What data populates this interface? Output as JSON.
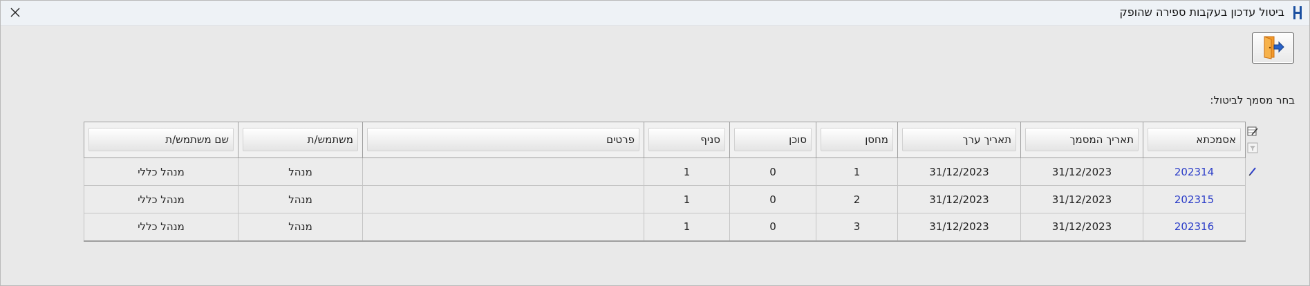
{
  "window": {
    "title": "ביטול עדכון בעקבות ספירה שהופק",
    "app_icon": "h-logo-icon",
    "close_icon": "close-icon"
  },
  "toolbar": {
    "exit_icon": "exit-door-icon"
  },
  "main": {
    "select_label": "בחר מסמך לביטול:"
  },
  "grid": {
    "columns": [
      "אסמכתא",
      "תאריך המסמך",
      "תאריך ערך",
      "מחסן",
      "סוכן",
      "סניף",
      "פרטים",
      "משתמש/ת",
      "שם משתמש/ת"
    ],
    "rows": [
      [
        "202314",
        "31/12/2023",
        "31/12/2023",
        "1",
        "0",
        "1",
        "",
        "מנהל",
        "מנהל כללי"
      ],
      [
        "202315",
        "31/12/2023",
        "31/12/2023",
        "2",
        "0",
        "1",
        "",
        "מנהל",
        "מנהל כללי"
      ],
      [
        "202316",
        "31/12/2023",
        "31/12/2023",
        "3",
        "0",
        "1",
        "",
        "מנהל",
        "מנהל כללי"
      ]
    ],
    "side_tools": [
      "edit-grid-icon",
      "filter-icon",
      "pencil-icon"
    ]
  },
  "colors": {
    "link": "#2a3cc8",
    "background": "#e9e9e9",
    "titlebar": "#eef2f6"
  }
}
